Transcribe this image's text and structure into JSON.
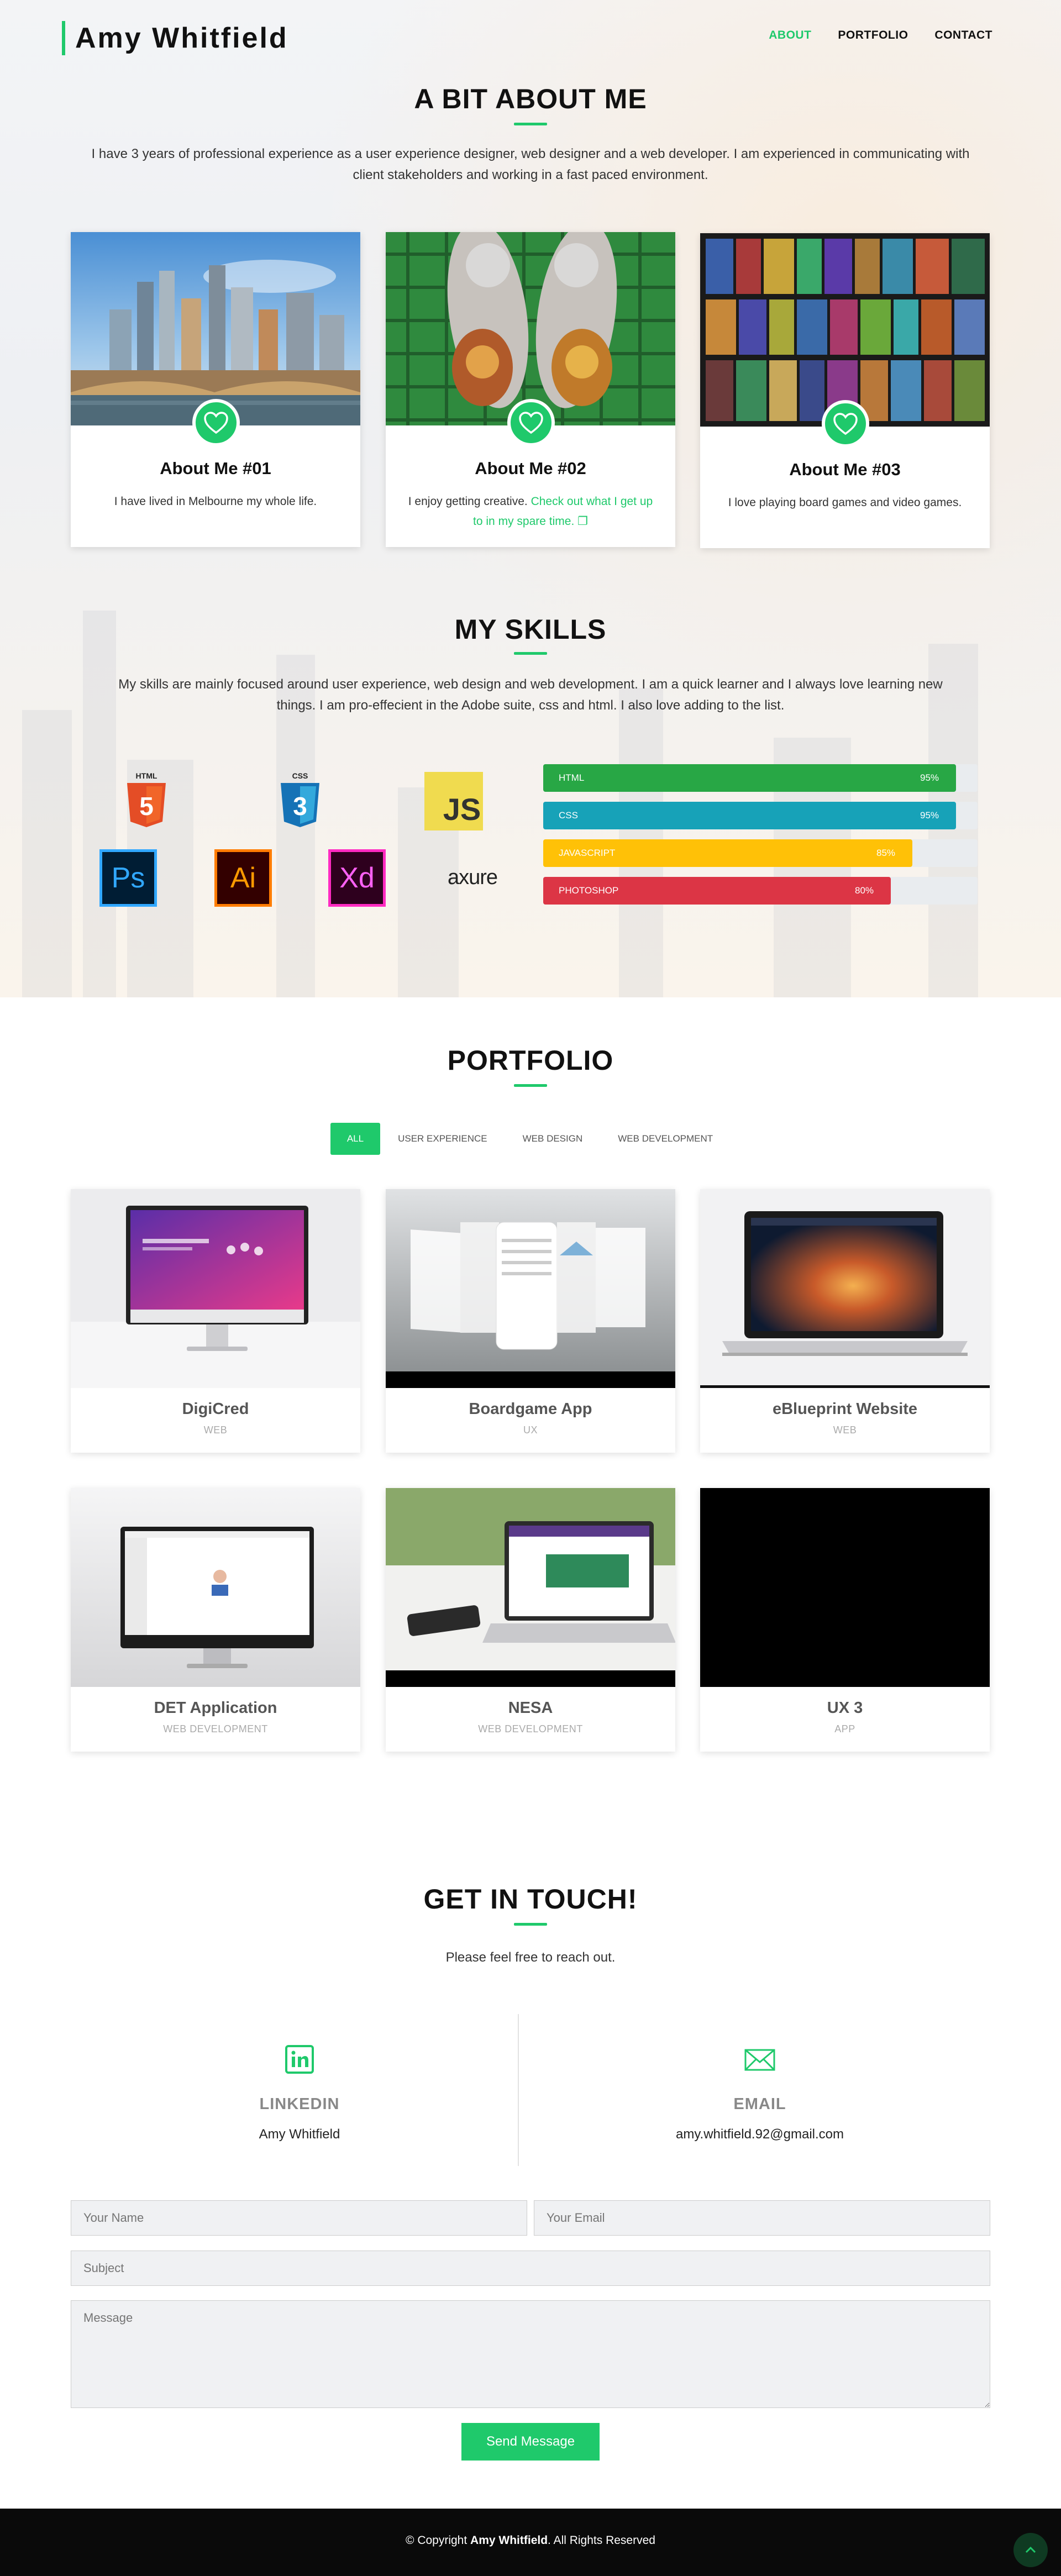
{
  "header": {
    "logo": "Amy Whitfield",
    "nav": [
      {
        "label": "ABOUT",
        "active": true
      },
      {
        "label": "PORTFOLIO",
        "active": false
      },
      {
        "label": "CONTACT",
        "active": false
      }
    ]
  },
  "about": {
    "title": "A BIT ABOUT ME",
    "intro_line1": "I have 3 years of professional experience as a user experience designer, web designer and a web developer. I am experienced in communicating with",
    "intro_line2": "client stakeholders and working in a fast paced environment.",
    "cards": [
      {
        "title": "About Me #01",
        "text": "I have lived in Melbourne my whole life.",
        "icon": "heart-icon"
      },
      {
        "title": "About Me #02",
        "text": "I enjoy getting creative.",
        "link_text_1": "Check out what I get up",
        "link_text_2": "to in my spare time.",
        "icon": "heart-icon"
      },
      {
        "title": "About Me #03",
        "text": "I love playing board games and video games.",
        "icon": "heart-icon"
      }
    ]
  },
  "skills": {
    "title": "MY SKILLS",
    "intro_line1": "My skills are mainly focused around user experience, web design and web development. I am a quick learner and I always love learning new",
    "intro_line2": "things. I am pro-effecient in the Adobe suite, css and html. I also love adding to the list.",
    "icons": [
      {
        "name": "html5-icon",
        "label": "HTML",
        "glyph": "5"
      },
      {
        "name": "css3-icon",
        "label": "CSS",
        "glyph": "3"
      },
      {
        "name": "javascript-icon",
        "glyph": "JS"
      },
      {
        "name": "photoshop-icon",
        "glyph": "Ps"
      },
      {
        "name": "illustrator-icon",
        "glyph": "Ai"
      },
      {
        "name": "xd-icon",
        "glyph": "Xd"
      },
      {
        "name": "axure-icon",
        "glyph": "axure"
      }
    ],
    "bars": [
      {
        "label": "HTML",
        "percent": 95,
        "percent_label": "95%",
        "color": "#28a745"
      },
      {
        "label": "CSS",
        "percent": 95,
        "percent_label": "95%",
        "color": "#17a2b8"
      },
      {
        "label": "JAVASCRIPT",
        "percent": 85,
        "percent_label": "85%",
        "color": "#ffc107"
      },
      {
        "label": "PHOTOSHOP",
        "percent": 80,
        "percent_label": "80%",
        "color": "#dc3545"
      }
    ]
  },
  "portfolio": {
    "title": "PORTFOLIO",
    "filters": [
      {
        "label": "ALL",
        "active": true
      },
      {
        "label": "USER EXPERIENCE",
        "active": false
      },
      {
        "label": "WEB DESIGN",
        "active": false
      },
      {
        "label": "WEB DEVELOPMENT",
        "active": false
      }
    ],
    "items": [
      {
        "title": "DigiCred",
        "category": "WEB"
      },
      {
        "title": "Boardgame App",
        "category": "UX"
      },
      {
        "title": "eBlueprint Website",
        "category": "WEB"
      },
      {
        "title": "DET Application",
        "category": "WEB DEVELOPMENT"
      },
      {
        "title": "NESA",
        "category": "WEB DEVELOPMENT"
      },
      {
        "title": "UX 3",
        "category": "APP"
      }
    ]
  },
  "contact": {
    "title": "GET IN TOUCH!",
    "subtitle": "Please feel free to reach out.",
    "linkedin_label": "LINKEDIN",
    "linkedin_value": "Amy Whitfield",
    "email_label": "EMAIL",
    "email_value": "amy.whitfield.92@gmail.com",
    "form": {
      "name_placeholder": "Your Name",
      "email_placeholder": "Your Email",
      "subject_placeholder": "Subject",
      "message_placeholder": "Message",
      "submit_label": "Send Message"
    }
  },
  "footer": {
    "copyright_prefix": "© Copyright",
    "copyright_name": "Amy Whitfield",
    "copyright_suffix": ". All Rights Reserved"
  },
  "colors": {
    "accent": "#1fc96b",
    "footer_bg": "#0a0a0a"
  }
}
